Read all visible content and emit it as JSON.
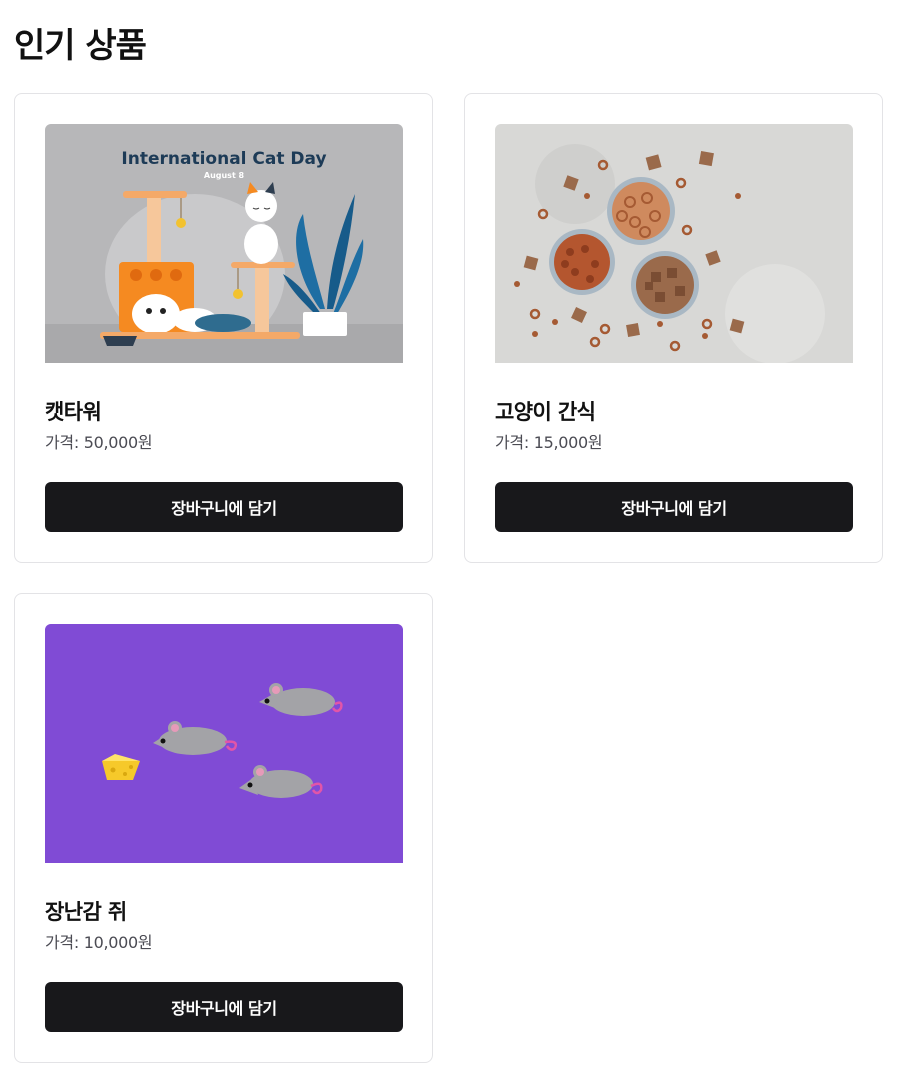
{
  "page": {
    "title": "인기 상품"
  },
  "products": [
    {
      "name": "캣타워",
      "price_text": "가격: 50,000원",
      "button_label": "장바구니에 담기",
      "image": {
        "banner_title": "International Cat Day",
        "banner_subtitle": "August 8",
        "background": "#b7b7b9"
      }
    },
    {
      "name": "고양이 간식",
      "price_text": "가격: 15,000원",
      "button_label": "장바구니에 담기",
      "image": {
        "background": "#d8d8d6"
      }
    },
    {
      "name": "장난감 쥐",
      "price_text": "가격: 10,000원",
      "button_label": "장바구니에 담기",
      "image": {
        "background": "#7b45d1"
      }
    }
  ],
  "colors": {
    "button_bg": "#18181b",
    "button_text": "#ffffff",
    "card_border": "#e3e3e6",
    "price_text": "#4b4b53"
  }
}
